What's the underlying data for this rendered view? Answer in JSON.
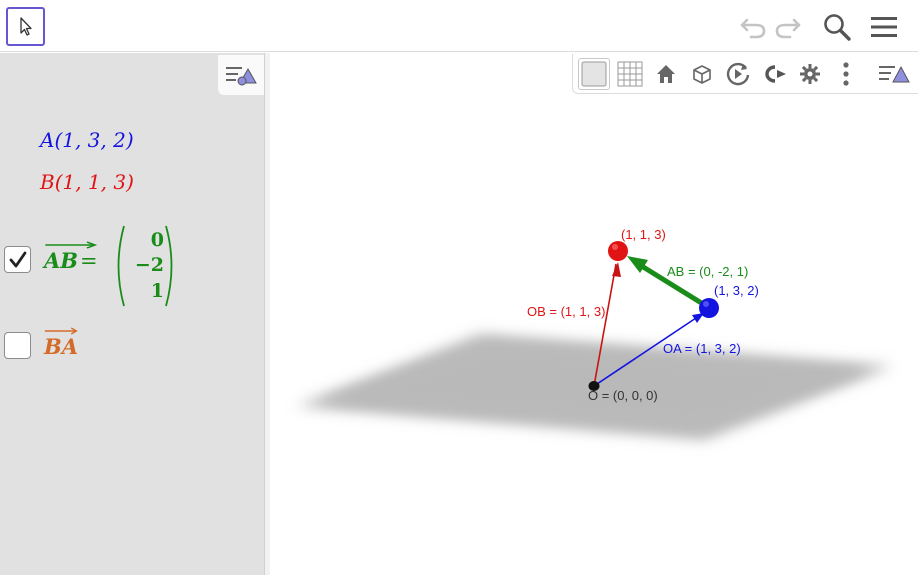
{
  "toolbar": {
    "icons": [
      "move-tool-icon",
      "undo-icon",
      "redo-icon",
      "search-icon",
      "menu-icon"
    ]
  },
  "algebra": {
    "point_a": "A(1, 3, 2)",
    "point_b": "B(1, 1, 3)",
    "vector_ab": {
      "label": "AB",
      "equals": "=",
      "checked": true,
      "components": [
        "0",
        "−2",
        "1"
      ],
      "color": "#1a8c1a"
    },
    "vector_ba": {
      "label": "BA",
      "checked": false,
      "color": "#d46a28"
    }
  },
  "graphics_toolbar": {
    "icons": [
      "axes-toggle-icon",
      "grid-icon",
      "home-icon",
      "cube-view-icon",
      "rotate-view-icon",
      "projection-icon",
      "settings-icon",
      "more-vertical-icon",
      "style-bar-icon"
    ]
  },
  "scene": {
    "labels": {
      "point_b": "(1, 1, 3)",
      "point_a": "(1, 3, 2)",
      "ab": "AB = (0, -2, 1)",
      "ob": "OB = (1, 1, 3)",
      "oa": "OA = (1, 3, 2)",
      "o": "O = (0, 0, 0)"
    },
    "colors": {
      "point_a": "#1414e0",
      "point_b": "#e01414",
      "vector_ab": "#1a8c1a",
      "origin": "#000000",
      "plane": "#bdbdbd"
    }
  }
}
